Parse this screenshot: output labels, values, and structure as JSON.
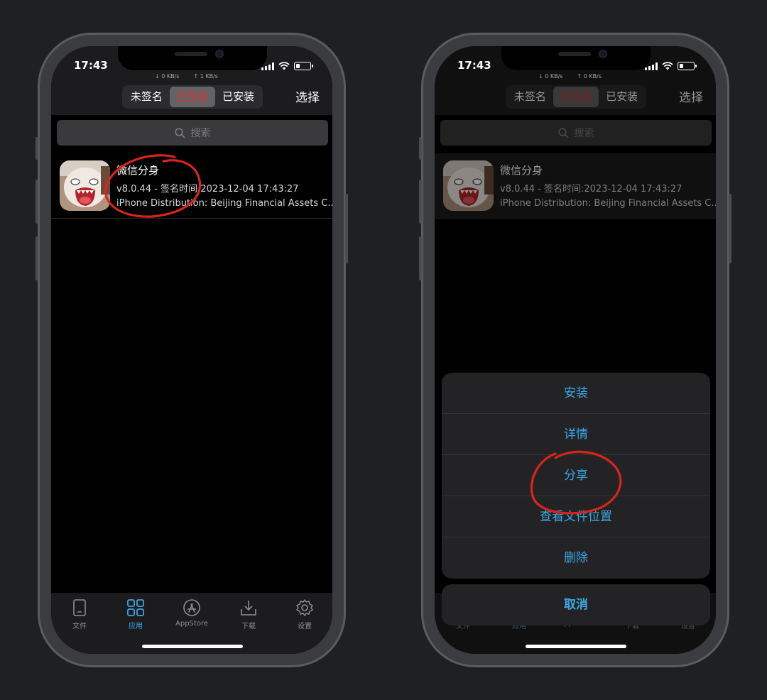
{
  "colors": {
    "accent": "#3aa7e5",
    "active_segment_text": "#e0312b",
    "annotation": "#d9241b"
  },
  "phones": [
    {
      "status": {
        "time": "17:43",
        "down_speed": "↓ 0 KB/s",
        "up_speed": "↑ 1 KB/s"
      },
      "segments": [
        "未签名",
        "已签名",
        "已安装"
      ],
      "active_segment": 1,
      "select_label": "选择",
      "search": {
        "placeholder": "搜索"
      },
      "app": {
        "name": "微信分身",
        "version_line": "v8.0.44 - 签名时间:2023-12-04 17:43:27",
        "cert_line": "iPhone Distribution: Beijing Financial Assets C..."
      },
      "tabs": [
        {
          "label": "文件",
          "icon": "file-icon"
        },
        {
          "label": "应用",
          "icon": "apps-grid-icon",
          "active": true
        },
        {
          "label": "AppStore",
          "icon": "appstore-icon"
        },
        {
          "label": "下载",
          "icon": "download-icon"
        },
        {
          "label": "设置",
          "icon": "gear-icon"
        }
      ]
    },
    {
      "status": {
        "time": "17:43",
        "down_speed": "↓ 0 KB/s",
        "up_speed": "↑ 0 KB/s"
      },
      "segments": [
        "未签名",
        "已签名",
        "已安装"
      ],
      "active_segment": 1,
      "select_label": "选择",
      "search": {
        "placeholder": "搜索"
      },
      "app": {
        "name": "微信分身",
        "version_line": "v8.0.44 - 签名时间:2023-12-04 17:43:27",
        "cert_line": "iPhone Distribution: Beijing Financial Assets C..."
      },
      "tabs": [
        {
          "label": "文件",
          "icon": "file-icon"
        },
        {
          "label": "应用",
          "icon": "apps-grid-icon",
          "active": true
        },
        {
          "label": "AppStore",
          "icon": "appstore-icon"
        },
        {
          "label": "下载",
          "icon": "download-icon"
        },
        {
          "label": "设置",
          "icon": "gear-icon"
        }
      ],
      "action_sheet": {
        "items": [
          "安装",
          "详情",
          "分享",
          "查看文件位置",
          "删除"
        ],
        "cancel": "取消"
      }
    }
  ]
}
